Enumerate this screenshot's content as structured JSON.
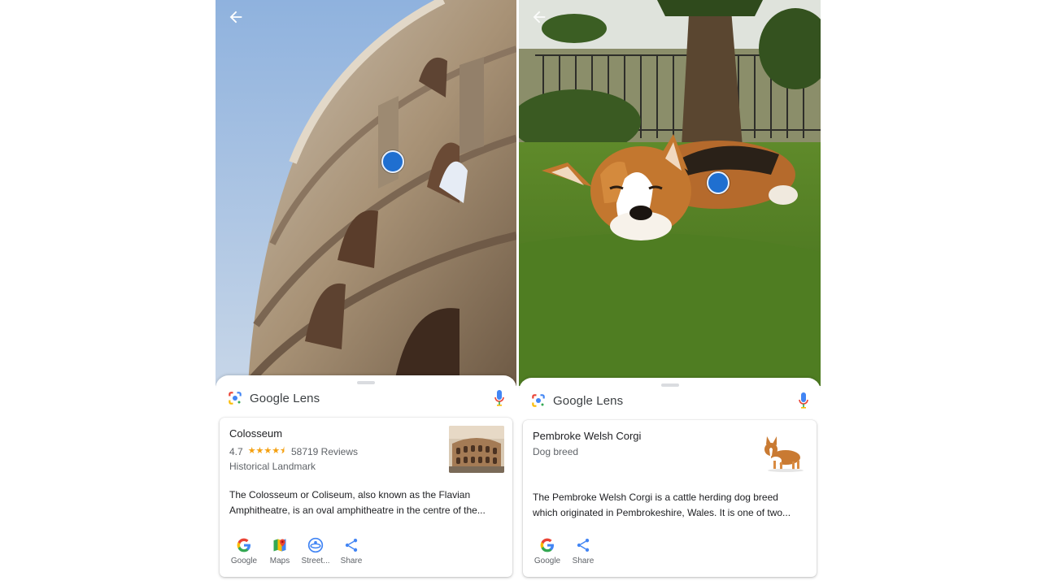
{
  "left": {
    "lens_title_google": "Google",
    "lens_title_lens": " Lens",
    "result": {
      "title": "Colosseum",
      "rating": "4.7",
      "stars_display": "★★★★⯨",
      "reviews": "58719 Reviews",
      "category": "Historical Landmark",
      "description_line1": "The Colosseum or Coliseum, also known as the Flavian",
      "description_line2": "Amphitheatre, is an oval amphitheatre in the centre of the..."
    },
    "actions": [
      {
        "label": "Google",
        "icon": "google-icon"
      },
      {
        "label": "Maps",
        "icon": "maps-icon"
      },
      {
        "label": "Street...",
        "icon": "street-view-icon"
      },
      {
        "label": "Share",
        "icon": "share-icon"
      }
    ]
  },
  "right": {
    "lens_title_google": "Google",
    "lens_title_lens": " Lens",
    "result": {
      "title": "Pembroke Welsh Corgi",
      "category": "Dog breed",
      "description_line1": "The Pembroke Welsh Corgi is a cattle herding dog breed",
      "description_line2": "which originated in Pembrokeshire, Wales. It is one of two..."
    },
    "actions": [
      {
        "label": "Google",
        "icon": "google-icon"
      },
      {
        "label": "Share",
        "icon": "share-icon"
      }
    ]
  },
  "colors": {
    "focus_dot": "#1f6fd0",
    "star": "#f4a010",
    "google_blue": "#4285f4",
    "google_red": "#ea4335",
    "google_yellow": "#fbbc05",
    "google_green": "#34a853"
  }
}
